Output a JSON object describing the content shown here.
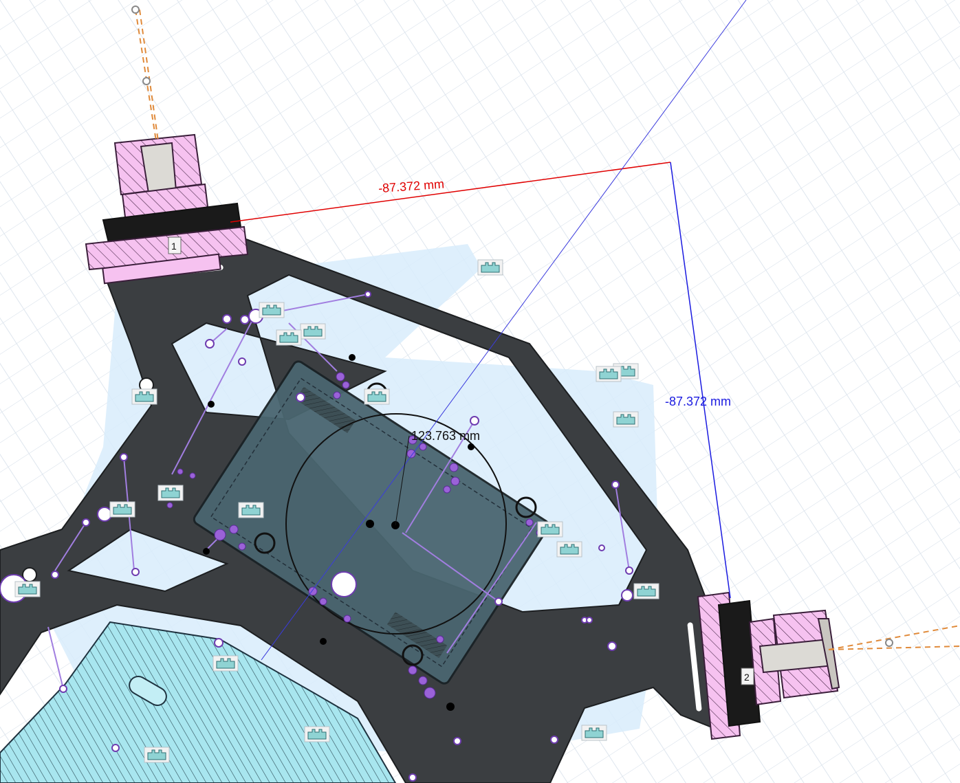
{
  "view": {
    "background": "#ffffff",
    "grid_color": "#cfd9e4",
    "plate_color": "#3b3e41",
    "highlight_color": "#d6ecfa",
    "purple": "#9b6ad6",
    "pink": "#f5b8ef",
    "cyan": "#a6e6ef"
  },
  "dimensions": {
    "horizontal": {
      "label": "-87.372 mm",
      "color": "#e00000"
    },
    "vertical": {
      "label": "-87.372 mm",
      "color": "#1a1ae0"
    },
    "diameter": {
      "label": "123.763 mm",
      "color": "#111111"
    }
  },
  "joints": [
    {
      "label": "1",
      "icon": "joint-1-icon"
    },
    {
      "label": "2",
      "icon": "joint-2-icon"
    }
  ],
  "constraint_glyphs": {
    "icon": "constraint-glyph-icon",
    "count": 20
  },
  "layers": [
    "sketch-grid",
    "highlight-region",
    "frame-plate",
    "motor-mount",
    "hatched-part",
    "sketch-geometry"
  ]
}
